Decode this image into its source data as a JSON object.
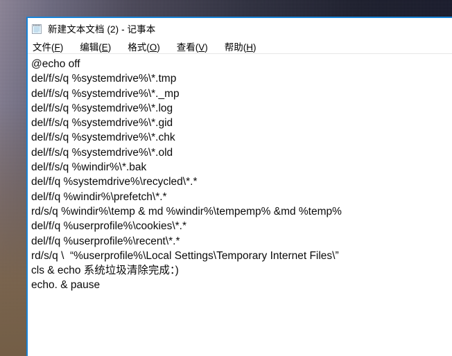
{
  "desktop": {
    "name": "desktop-wallpaper",
    "colors": {
      "top_left": "#8d8598",
      "top_right": "#15172a",
      "bottom_left": "#735e4a",
      "accent_border": "#1683d8"
    }
  },
  "window": {
    "app": "Notepad",
    "icon": "notepad-icon",
    "title": "新建文本文档 (2) - 记事本",
    "document_name": "新建文本文档 (2)",
    "app_name": "记事本"
  },
  "menu": {
    "items": [
      {
        "label": "文件",
        "accel": "F",
        "open_paren": "(",
        "close_paren": ")"
      },
      {
        "label": "编辑",
        "accel": "E",
        "open_paren": "(",
        "close_paren": ")"
      },
      {
        "label": "格式",
        "accel": "O",
        "open_paren": "(",
        "close_paren": ")"
      },
      {
        "label": "查看",
        "accel": "V",
        "open_paren": "(",
        "close_paren": ")"
      },
      {
        "label": "帮助",
        "accel": "H",
        "open_paren": "(",
        "close_paren": ")"
      }
    ]
  },
  "editor": {
    "placeholder": "",
    "lines": [
      "@echo off",
      "del/f/s/q %systemdrive%\\*.tmp",
      "del/f/s/q %systemdrive%\\*._mp",
      "del/f/s/q %systemdrive%\\*.log",
      "del/f/s/q %systemdrive%\\*.gid",
      "del/f/s/q %systemdrive%\\*.chk",
      "del/f/s/q %systemdrive%\\*.old",
      "del/f/s/q %windir%\\*.bak",
      "del/f/q %systemdrive%\\recycled\\*.*",
      "del/f/q %windir%\\prefetch\\*.*",
      "rd/s/q %windir%\\temp & md %windir%\\tempemp% &md %temp%",
      "del/f/q %userprofile%\\cookies\\*.*",
      "del/f/q %userprofile%\\recent\\*.*",
      "rd/s/q \\  “%userprofile%\\Local Settings\\Temporary Internet Files\\”",
      "cls & echo 系统垃圾清除完成：)",
      "echo. & pause"
    ]
  }
}
